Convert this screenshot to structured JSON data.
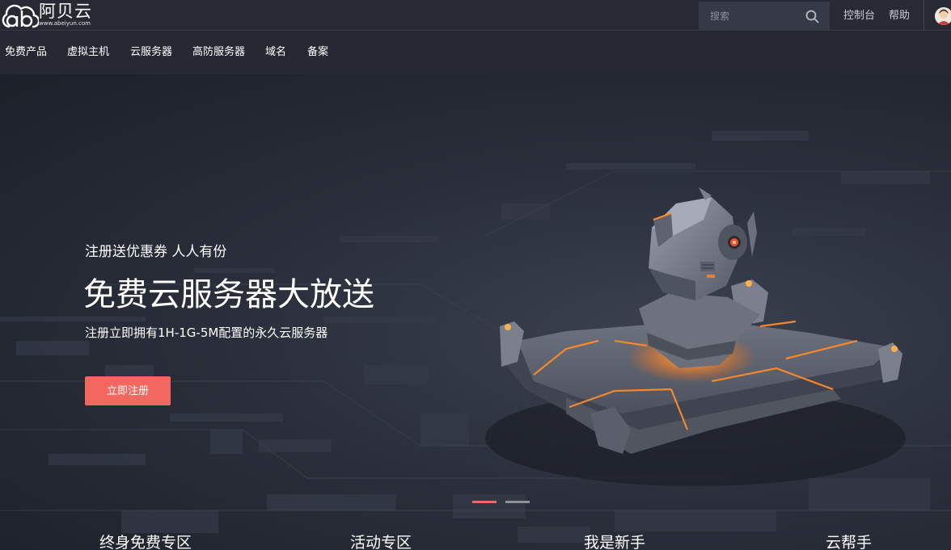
{
  "brand": {
    "name": "阿贝云",
    "url": "www.abeiyun.com"
  },
  "search": {
    "placeholder": "搜索"
  },
  "top_links": {
    "console": "控制台",
    "help": "帮助"
  },
  "nav": {
    "items": [
      "免费产品",
      "虚拟主机",
      "云服务器",
      "高防服务器",
      "域名",
      "备案"
    ]
  },
  "hero": {
    "eyebrow": "注册送优惠券 人人有份",
    "title": "免费云服务器大放送",
    "subtitle": "注册立即拥有1H-1G-5M配置的永久云服务器",
    "cta_label": "立即注册"
  },
  "carousel": {
    "slide_count": 2,
    "active_index": 0
  },
  "quick_entries": [
    "终身免费专区",
    "活动专区",
    "我是新手",
    "云帮手"
  ],
  "colors": {
    "accent": "#f2675f",
    "topbar": "#272a35",
    "navbar": "#262934",
    "glow": "#ff8a2a"
  }
}
